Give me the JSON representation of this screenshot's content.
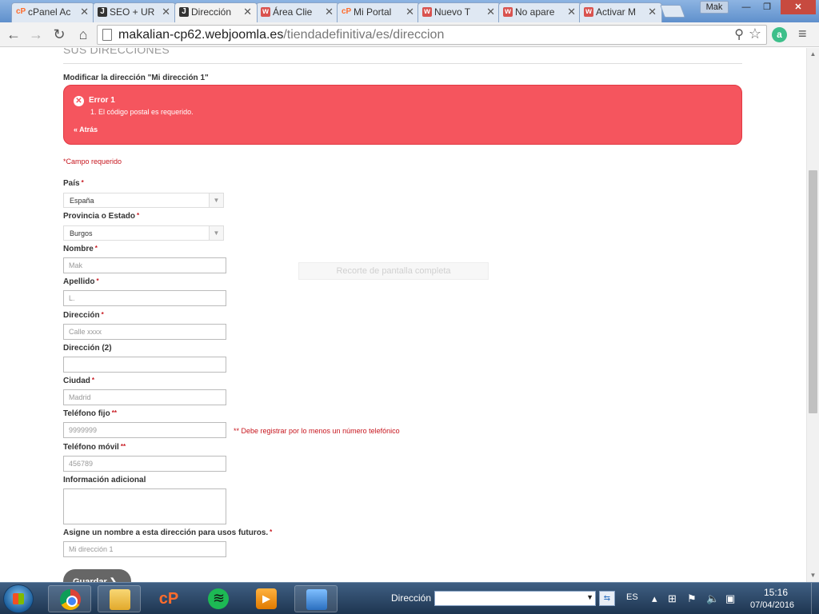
{
  "browser": {
    "tabs": [
      {
        "label": "cPanel Ac",
        "favicon": "cp"
      },
      {
        "label": "SEO + UR",
        "favicon": "joomla"
      },
      {
        "label": "Dirección",
        "favicon": "joomla",
        "active": true
      },
      {
        "label": "Área Clie",
        "favicon": "w"
      },
      {
        "label": "Mi Portal",
        "favicon": "cp"
      },
      {
        "label": "Nuevo T",
        "favicon": "w"
      },
      {
        "label": "No apare",
        "favicon": "w"
      },
      {
        "label": "Activar M",
        "favicon": "w"
      }
    ],
    "tab_close": "✕",
    "user": "Mak",
    "window_controls": {
      "minimize": "—",
      "restore": "❐",
      "close": "✕"
    },
    "url_domain": "makalian-cp62.webjoomla.es",
    "url_path": "/tiendadefinitiva/es/direccion",
    "extension_letter": "a"
  },
  "page": {
    "section_title": "SUS DIRECCIONES",
    "subtitle": "Modificar la dirección \"Mi dirección 1\"",
    "error": {
      "title": "Error 1",
      "item": "1. El código postal es requerido.",
      "back": "« Atrás"
    },
    "required_note": "*Campo requerido",
    "fields": {
      "pais": {
        "label": "País",
        "value": "España"
      },
      "provincia": {
        "label": "Provincia o Estado",
        "value": "Burgos"
      },
      "nombre": {
        "label": "Nombre",
        "value": "Mak"
      },
      "apellido": {
        "label": "Apellido",
        "value": "L."
      },
      "direccion": {
        "label": "Dirección",
        "value": "Calle xxxx"
      },
      "direccion2": {
        "label": "Dirección (2)",
        "value": ""
      },
      "ciudad": {
        "label": "Ciudad",
        "value": "Madrid"
      },
      "telefono_fijo": {
        "label": "Teléfono fijo",
        "value": "9999999"
      },
      "telefono_movil": {
        "label": "Teléfono móvil",
        "value": "456789"
      },
      "info_adicional": {
        "label": "Información adicional",
        "value": ""
      },
      "alias": {
        "label": "Asigne un nombre a esta dirección para usos futuros.",
        "value": "Mi dirección 1"
      }
    },
    "required_mark": "*",
    "phone_mark": "**",
    "phone_note": "** Debe registrar por lo menos un número telefónico",
    "overlay_text": "Recorte de pantalla completa",
    "save_label": "Guardar ❯"
  },
  "taskbar": {
    "cp_label": "cP",
    "address_label": "Dirección",
    "lang": "ES",
    "time": "15:16",
    "date": "07/04/2016"
  },
  "colors": {
    "error_bg": "#f5555e",
    "required": "#c7161e",
    "save_button": "#666666"
  }
}
